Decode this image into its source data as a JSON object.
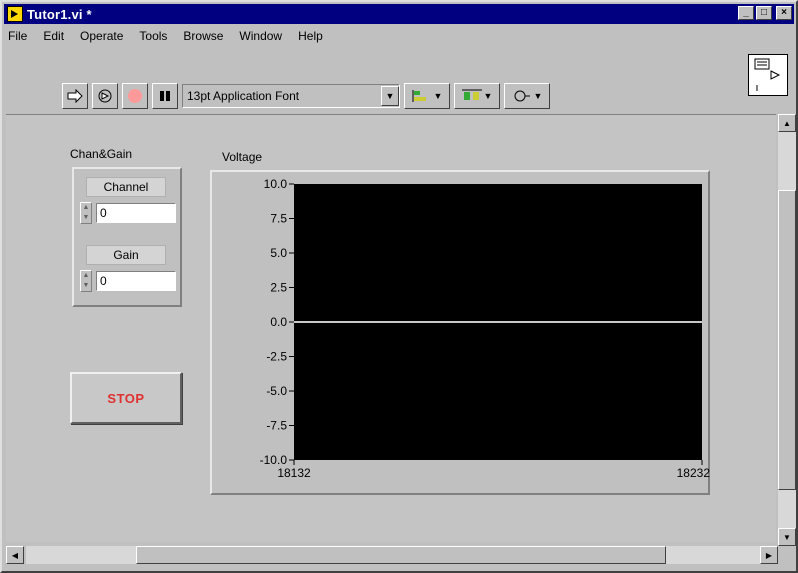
{
  "window": {
    "title": "Tutor1.vi *",
    "title_buttons": {
      "minimize": "_",
      "maximize": "□",
      "close": "×"
    }
  },
  "menu": {
    "file": "File",
    "edit": "Edit",
    "operate": "Operate",
    "tools": "Tools",
    "browse": "Browse",
    "window": "Window",
    "help": "Help"
  },
  "toolbar": {
    "font": "13pt Application Font",
    "icons": [
      "run-arrow-icon",
      "run-continuously-icon",
      "abort-icon",
      "pause-icon",
      "align-objects-icon",
      "distribute-objects-icon",
      "reorder-icon"
    ]
  },
  "panel": {
    "cluster": {
      "label": "Chan&Gain",
      "channel": {
        "label": "Channel",
        "value": "0"
      },
      "gain": {
        "label": "Gain",
        "value": "0"
      }
    },
    "stop": "STOP",
    "chart": {
      "label": "Voltage"
    }
  },
  "chart_data": {
    "type": "line",
    "title": "Voltage",
    "xlabel": "",
    "ylabel": "",
    "x": [
      18132,
      18232
    ],
    "series": [
      {
        "values": [
          0.0,
          0.0
        ]
      }
    ],
    "xlim": [
      18132,
      18232
    ],
    "ylim": [
      -10.0,
      10.0
    ],
    "yticks": [
      "10.0",
      "7.5",
      "5.0",
      "2.5",
      "0.0",
      "-2.5",
      "-5.0",
      "-7.5",
      "-10.0"
    ],
    "xticks": [
      "18132",
      "18232"
    ],
    "background": "#000000",
    "line_color": "#c8c8c8",
    "grid": false
  }
}
